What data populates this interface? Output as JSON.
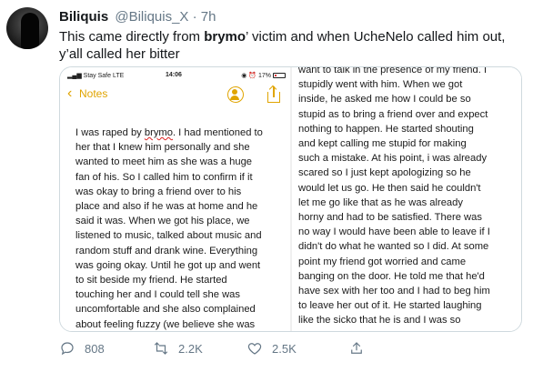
{
  "tweet": {
    "author_name": "Biliquis",
    "handle_time": "@Biliquis_X · 7h",
    "text_before": "This came directly from ",
    "text_bold": "brymo",
    "text_line1_after": "’ victim and when UcheNelo called him out,",
    "text_line2": "y’all called her bitter"
  },
  "screenshot": {
    "status": {
      "carrier": "Stay Safe  LTE",
      "time": "14:06",
      "battery": "17%"
    },
    "nav": {
      "back_label": "Notes"
    },
    "left_lines": [
      "I was raped by brymo. I had mentioned to",
      "her that I knew him personally and she",
      "wanted to meet him as she was a huge",
      "fan of his. So I called him to confirm if it",
      "was okay to bring a friend over to his",
      "place and also if he was at home and he",
      "said it was. When we got his place, we",
      "listened to music, talked about music and",
      "random stuff and drank wine. Everything",
      "was going okay. Until he got up and went",
      "to sit beside my friend. He started",
      "touching her and I could tell she was",
      "uncomfortable and she also complained",
      "about feeling fuzzy (we believe she was"
    ],
    "right_lines": [
      "want to talk in the presence of my friend. I",
      "stupidly went with him. When we got",
      "inside, he asked me how I could be so",
      "stupid as to bring a friend over and expect",
      "nothing to happen. He started shouting",
      "and kept calling me stupid for making",
      "such a mistake. At his point, i was already",
      "scared so I just kept apologizing so he",
      "would let us go. He then said he couldn't",
      "let me go like that as he was already",
      "horny and had to be satisfied. There was",
      "no way I would have been able to leave if I",
      "didn't do what he wanted so I did. At some",
      "point my friend got worried and came",
      "banging on the door. He told me that he'd",
      "have sex with her too and I had to beg him",
      "to leave her out of it. He started laughing",
      "like the sicko that he is and I was so"
    ]
  },
  "actions": {
    "replies": "808",
    "retweets": "2.2K",
    "likes": "2.5K"
  },
  "colors": {
    "accent": "#e0a400",
    "muted": "#657786"
  }
}
